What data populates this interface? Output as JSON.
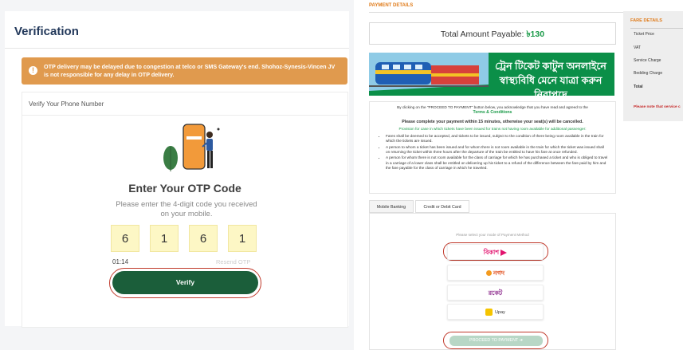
{
  "verification": {
    "title": "Verification",
    "alert_text": "OTP delivery may be delayed due to congestion at telco or SMS Gateway's end. Shohoz-Synesis-Vincen JV is not responsible for any delay in OTP delivery.",
    "alert_icon": "exclamation-icon",
    "phone_label": "Verify Your Phone Number",
    "otp_title": "Enter Your OTP Code",
    "otp_subtitle": "Please enter the 4-digit code you received on your mobile.",
    "otp_digits": [
      "6",
      "1",
      "6",
      "1"
    ],
    "timer": "01:14",
    "resend_label": "Resend OTP",
    "verify_label": "Verify"
  },
  "payment": {
    "section_title": "PAYMENT DETAILS",
    "total_label": "Total Amount Payable: ",
    "total_value": "৳130",
    "banner_line1": "ট্রেন টিকেট কাটুন অনলাইনে",
    "banner_line2": "স্বাস্থ্যবিধি মেনে যাত্রা করুন নিরাপদে",
    "terms": {
      "intro": "By clicking on the \"PROCEED TO PAYMENT\" button below, you acknowledge that you have read and agreed to the",
      "link": "Terms & Conditions",
      "warning": "Please complete your payment within 15 minutes, otherwise your seat(s) will be cancelled.",
      "provision": "Provision for case in which tickets have been issued for trains not having room available for additional passenger:",
      "bullets": [
        "Fares shall be deemed to be accepted, and tickets to be issued, subject to the condition of there being room available in the train for which the tickets are issued.",
        "A person to whom a ticket has been issued and for whom there is not room available in the train for which the ticket was issued shall on returning the ticket within three hours after the departure of the train be entitled to have his fare at once refunded.",
        "A person for whom there is not room available for the class of carriage for which he has purchased a ticket and who is obliged to travel in a carriage of a lower class shall be entitled on delivering up his ticket to a refund of the difference between the fare paid by him and the fare payable for the class of carriage in which he traveled."
      ]
    },
    "tabs": [
      "Mobile Banking",
      "Credit or Debit Card"
    ],
    "select_label": "Please select your mode of Payment Method",
    "methods": [
      "বিকাশ",
      "নগদ",
      "রকেট",
      "Upay"
    ],
    "proceed_label": "PROCEED TO PAYMENT ➔",
    "colors": {
      "accent": "#1a9a48",
      "highlight": "#c0392b",
      "orange": "#e07b1a"
    }
  },
  "fare": {
    "title": "FARE DETAILS",
    "items": [
      "Ticket Price",
      "VAT",
      "Service Charge",
      "Bedding Charge",
      "Total"
    ],
    "note": "Please note that service c"
  }
}
